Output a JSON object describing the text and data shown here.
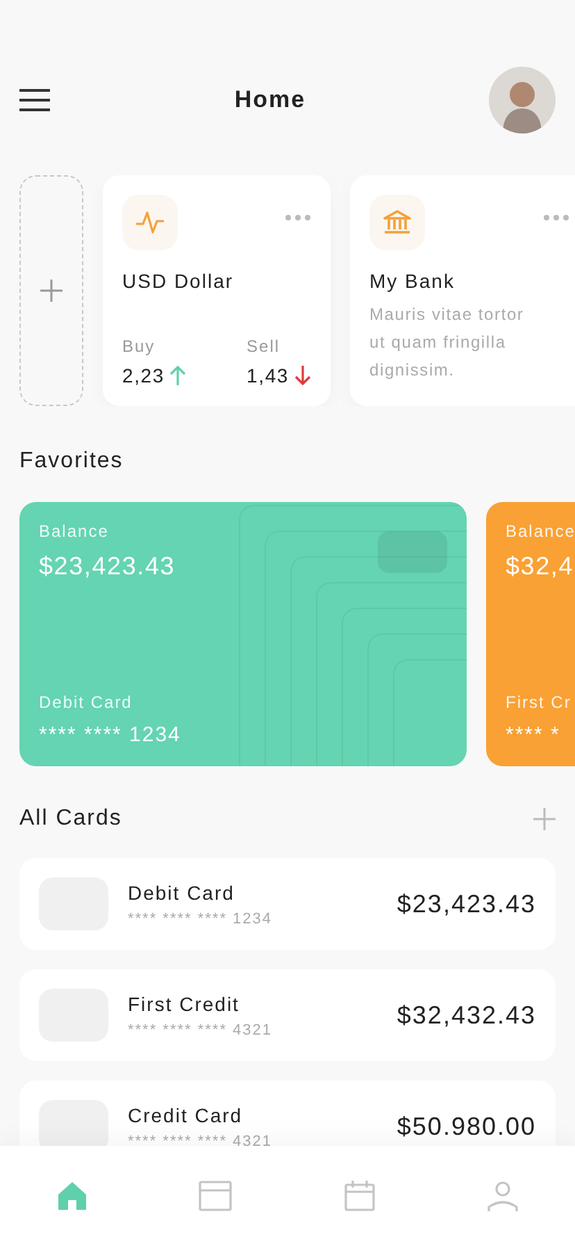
{
  "header": {
    "title": "Home"
  },
  "quick_cards": [
    {
      "kind": "add"
    },
    {
      "kind": "rate",
      "title": "USD Dollar",
      "buy_label": "Buy",
      "buy_value": "2,23",
      "buy_rising": true,
      "sell_label": "Sell",
      "sell_value": "1,43",
      "sell_rising": false
    },
    {
      "kind": "info",
      "title": "My Bank",
      "text": "Mauris vitae tortor ut quam fringilla dignissim."
    }
  ],
  "favorites": {
    "title": "Favorites",
    "cards": [
      {
        "label": "Balance",
        "amount": "$23,423.43",
        "name": "Debit Card",
        "number": "**** **** 1234",
        "color": "#64d4b2"
      },
      {
        "label": "Balance",
        "amount": "$32,4",
        "name": "First Cr",
        "number": "**** *",
        "color": "#f9a134"
      }
    ]
  },
  "all_cards": {
    "title": "All Cards",
    "items": [
      {
        "name": "Debit Card",
        "number": "**** **** **** 1234",
        "amount": "$23,423.43"
      },
      {
        "name": "First Credit",
        "number": "**** **** **** 4321",
        "amount": "$32,432.43"
      },
      {
        "name": "Credit Card",
        "number": "**** **** **** 4321",
        "amount": "$50.980.00"
      }
    ]
  },
  "tab_bar": [
    {
      "kind": "home",
      "selected": true
    },
    {
      "kind": "card",
      "selected": false
    },
    {
      "kind": "calendar",
      "selected": false
    },
    {
      "kind": "profile",
      "selected": false
    }
  ]
}
